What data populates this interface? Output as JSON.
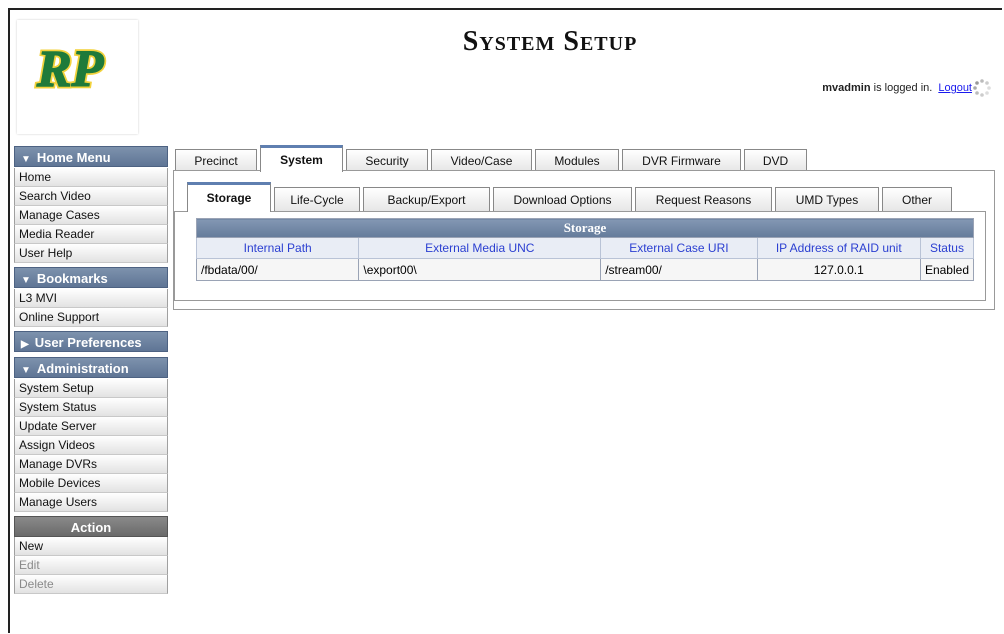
{
  "header": {
    "logo_text": "RP",
    "title": "System Setup",
    "user": "mvadmin",
    "logged_in_text": " is logged in.",
    "logout_label": "Logout"
  },
  "sidebar": {
    "home_menu": {
      "title": "Home Menu",
      "items": [
        "Home",
        "Search Video",
        "Manage Cases",
        "Media Reader",
        "User Help"
      ]
    },
    "bookmarks": {
      "title": "Bookmarks",
      "items": [
        "L3 MVI",
        "Online Support"
      ]
    },
    "user_prefs": {
      "title": "User Preferences"
    },
    "administration": {
      "title": "Administration",
      "items": [
        "System Setup",
        "System Status",
        "Update Server",
        "Assign Videos",
        "Manage DVRs",
        "Mobile Devices",
        "Manage Users"
      ]
    },
    "action": {
      "title": "Action",
      "items": [
        "New",
        "Edit",
        "Delete"
      ]
    }
  },
  "tabs": [
    "Precinct",
    "System",
    "Security",
    "Video/Case",
    "Modules",
    "DVR Firmware",
    "DVD"
  ],
  "active_tab": "System",
  "subtabs": [
    "Storage",
    "Life-Cycle",
    "Backup/Export",
    "Download Options",
    "Request Reasons",
    "UMD Types",
    "Other"
  ],
  "active_subtab": "Storage",
  "storage_table": {
    "caption": "Storage",
    "headers": [
      "Internal Path",
      "External Media UNC",
      "External Case URI",
      "IP Address of RAID unit",
      "Status"
    ],
    "rows": [
      [
        "/fbdata/00/",
        "\\export00\\",
        "/stream00/",
        "127.0.0.1",
        "Enabled"
      ]
    ]
  },
  "colors": {
    "accent": "#5f7fb0",
    "header_bg": "#647b9a",
    "logo_green": "#1f7a3a",
    "logo_yellow": "#f2d23c"
  }
}
